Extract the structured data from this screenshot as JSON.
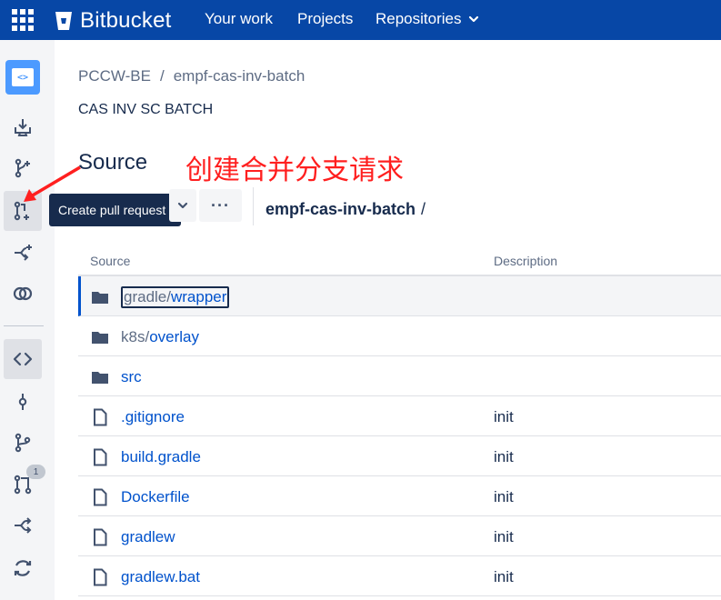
{
  "topbar": {
    "logo_text": "Bitbucket",
    "nav": [
      "Your work",
      "Projects",
      "Repositories"
    ]
  },
  "sidebar": {
    "tooltip": "Create pull request",
    "pr_badge": "1",
    "icons": [
      "repo-avatar-icon",
      "clone-icon",
      "create-branch-icon",
      "create-pull-request-icon",
      "create-fork-icon",
      "compare-icon",
      "source-icon",
      "commits-icon",
      "branches-icon",
      "pull-requests-icon",
      "forks-icon",
      "pipelines-icon"
    ]
  },
  "annotation": "创建合并分支请求",
  "breadcrumb": {
    "project": "PCCW-BE",
    "separator": "/",
    "repo": "empf-cas-inv-batch"
  },
  "repo_description": "CAS INV SC BATCH",
  "page_title": "Source",
  "path": {
    "repo": "empf-cas-inv-batch",
    "slash": "/"
  },
  "more_label": "···",
  "table": {
    "headers": {
      "source": "Source",
      "description": "Description"
    },
    "rows": [
      {
        "type": "folder",
        "prefix": "gradle/",
        "name": "wrapper",
        "desc": ""
      },
      {
        "type": "folder",
        "prefix": "k8s/",
        "name": "overlay",
        "desc": ""
      },
      {
        "type": "folder",
        "prefix": "",
        "name": "src",
        "desc": ""
      },
      {
        "type": "file",
        "prefix": "",
        "name": ".gitignore",
        "desc": "init"
      },
      {
        "type": "file",
        "prefix": "",
        "name": "build.gradle",
        "desc": "init"
      },
      {
        "type": "file",
        "prefix": "",
        "name": "Dockerfile",
        "desc": "init"
      },
      {
        "type": "file",
        "prefix": "",
        "name": "gradlew",
        "desc": "init"
      },
      {
        "type": "file",
        "prefix": "",
        "name": "gradlew.bat",
        "desc": "init"
      }
    ]
  },
  "colors": {
    "topbar": "#0747a6",
    "link": "#0052cc",
    "annotation": "#ff1f1f",
    "tooltip_bg": "#172b4d"
  }
}
